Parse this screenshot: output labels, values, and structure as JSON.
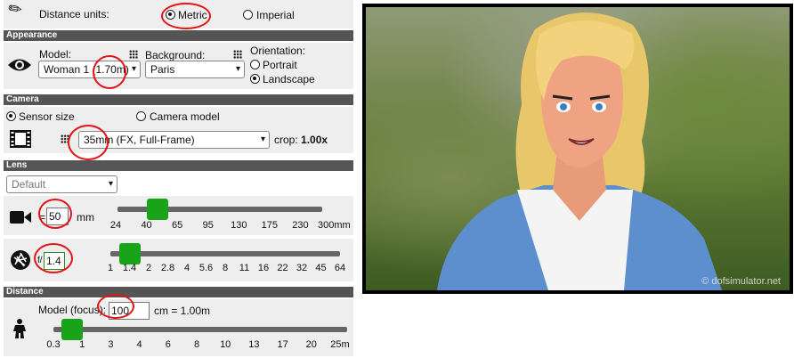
{
  "units": {
    "label": "Distance units:",
    "metric": "Metric",
    "imperial": "Imperial",
    "selected": "Metric"
  },
  "appearance": {
    "header": "Appearance",
    "model_label": "Model:",
    "model_value": "Woman 1 (1.70m)",
    "background_label": "Background:",
    "background_value": "Paris",
    "orientation_label": "Orientation:",
    "portrait": "Portrait",
    "landscape": "Landscape",
    "selected_orientation": "Landscape"
  },
  "camera": {
    "header": "Camera",
    "sensor_size": "Sensor size",
    "camera_model": "Camera model",
    "selected": "Sensor size",
    "sensor_value": "35mm (FX, Full-Frame)",
    "crop_label": "crop:",
    "crop_value": "1.00x"
  },
  "lens": {
    "header": "Lens",
    "preset_value": "Default",
    "focal_prefix": "=",
    "focal_value": "50",
    "focal_unit": "mm",
    "focal_ticks": [
      "24",
      "40",
      "65",
      "95",
      "130",
      "175",
      "230",
      "300mm"
    ],
    "focal_slider_fraction": 0.27,
    "aperture_prefix": "f/",
    "aperture_value": "1.4",
    "aperture_ticks": [
      "1",
      "1.4",
      "2",
      "2.8",
      "4",
      "5.6",
      "8",
      "11",
      "16",
      "22",
      "32",
      "45",
      "64"
    ],
    "aperture_slider_fraction": 0.08
  },
  "distance": {
    "header": "Distance",
    "label": "Model (focus):",
    "value": "100",
    "result": "cm = 1.00m",
    "ticks": [
      "0.3",
      "1",
      "3",
      "4",
      "6",
      "8",
      "10",
      "13",
      "17",
      "20",
      "25m"
    ],
    "slider_fraction": 0.08
  },
  "preview": {
    "watermark": "© dofsimulator.net"
  },
  "colors": {
    "header_bg": "#555555",
    "slider_knob": "#19a319",
    "annotation": "#e21414"
  }
}
